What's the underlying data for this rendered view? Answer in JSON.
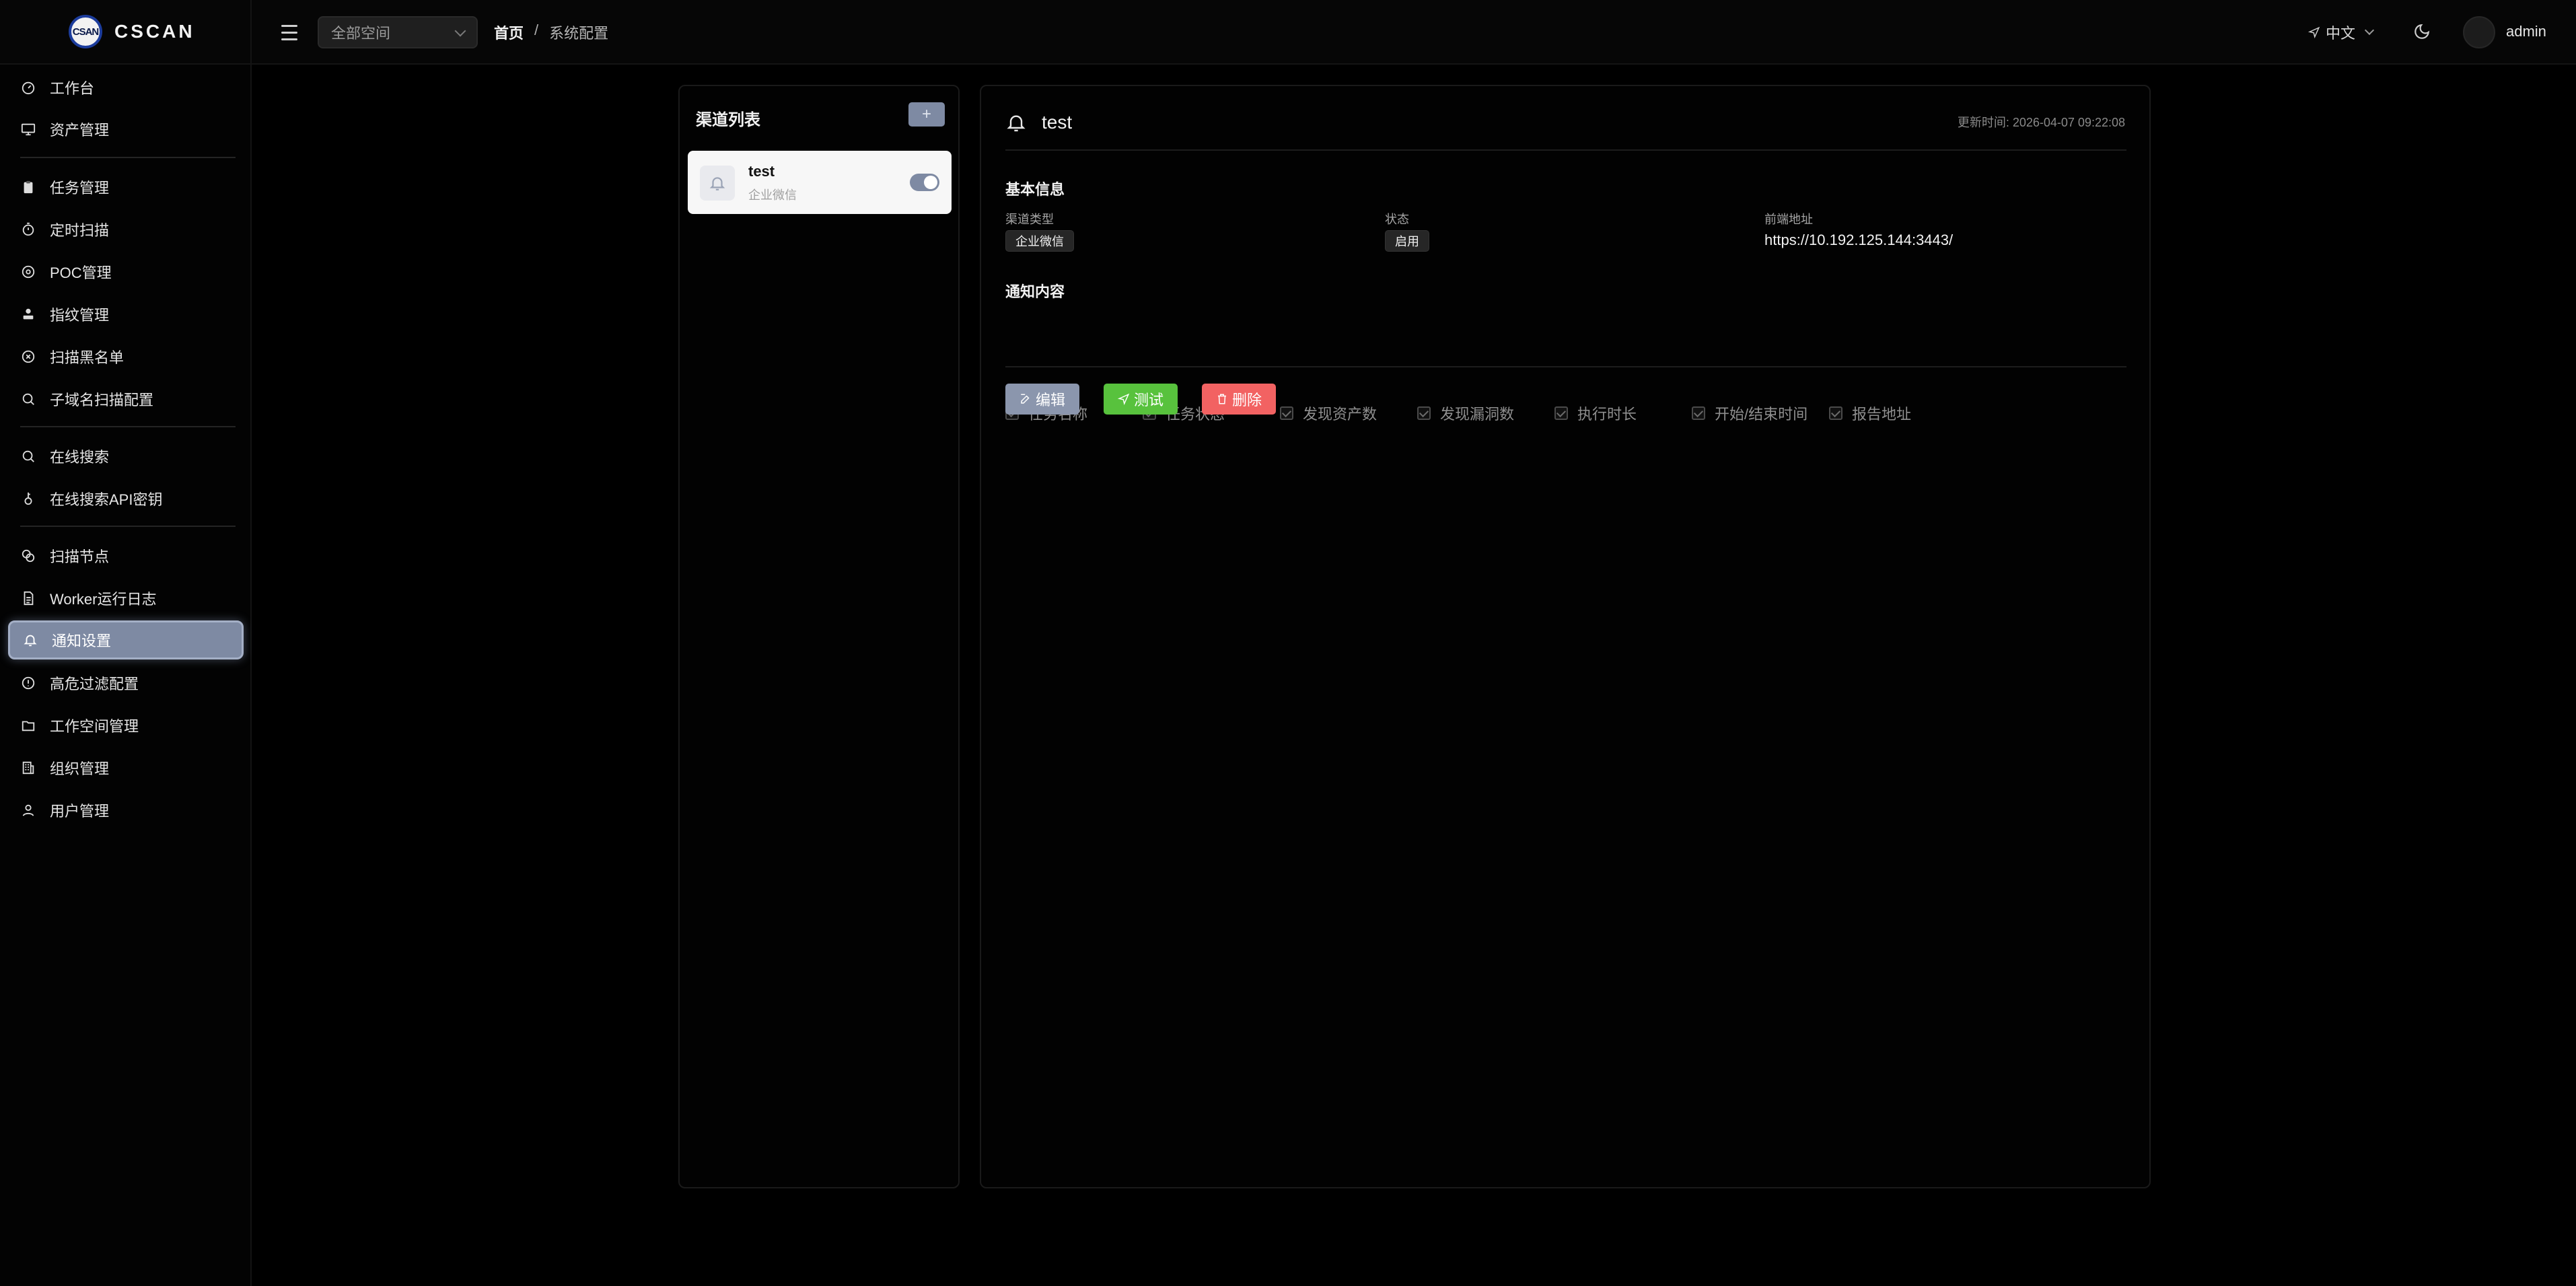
{
  "app": {
    "logo_badge": "CSAN",
    "brand": "CSCAN"
  },
  "header": {
    "workspace_select": "全部空间",
    "breadcrumb": {
      "home": "首页",
      "separator": "/",
      "current": "系统配置"
    },
    "language": "中文",
    "username": "admin"
  },
  "sidebar": {
    "items": [
      {
        "label": "工作台",
        "icon": "dashboard-icon"
      },
      {
        "label": "资产管理",
        "icon": "monitor-icon"
      },
      {
        "label": "任务管理",
        "icon": "clipboard-icon"
      },
      {
        "label": "定时扫描",
        "icon": "timer-icon"
      },
      {
        "label": "POC管理",
        "icon": "target-icon"
      },
      {
        "label": "指纹管理",
        "icon": "stamp-icon"
      },
      {
        "label": "扫描黑名单",
        "icon": "circle-x-icon"
      },
      {
        "label": "子域名扫描配置",
        "icon": "search-icon"
      },
      {
        "label": "在线搜索",
        "icon": "search-icon"
      },
      {
        "label": "在线搜索API密钥",
        "icon": "key-icon"
      },
      {
        "label": "扫描节点",
        "icon": "nodes-icon"
      },
      {
        "label": "Worker运行日志",
        "icon": "document-icon"
      },
      {
        "label": "通知设置",
        "icon": "bell-icon",
        "active": true
      },
      {
        "label": "高危过滤配置",
        "icon": "alert-circle-icon"
      },
      {
        "label": "工作空间管理",
        "icon": "folder-icon"
      },
      {
        "label": "组织管理",
        "icon": "building-icon"
      },
      {
        "label": "用户管理",
        "icon": "user-icon"
      }
    ]
  },
  "channel_list": {
    "title": "渠道列表",
    "add_label": "+",
    "channels": [
      {
        "name": "test",
        "type": "企业微信",
        "enabled": true
      }
    ]
  },
  "detail": {
    "title": "test",
    "update_time": "更新时间: 2026-04-07 09:22:08",
    "basic_info_title": "基本信息",
    "fields": {
      "channel_type_label": "渠道类型",
      "channel_type_value": "企业微信",
      "status_label": "状态",
      "status_value": "启用",
      "frontend_label": "前端地址",
      "frontend_value": "https://10.192.125.144:3443/"
    },
    "notify_content_title": "通知内容",
    "notify_items": [
      "任务名称",
      "任务状态",
      "发现资产数",
      "发现漏洞数",
      "执行时长",
      "开始/结束时间",
      "报告地址"
    ],
    "buttons": {
      "edit": "编辑",
      "test": "测试",
      "delete": "删除"
    }
  },
  "colors": {
    "accent": "#7e8aa3",
    "success": "#58c23d",
    "danger": "#f26262",
    "background": "#000000"
  }
}
